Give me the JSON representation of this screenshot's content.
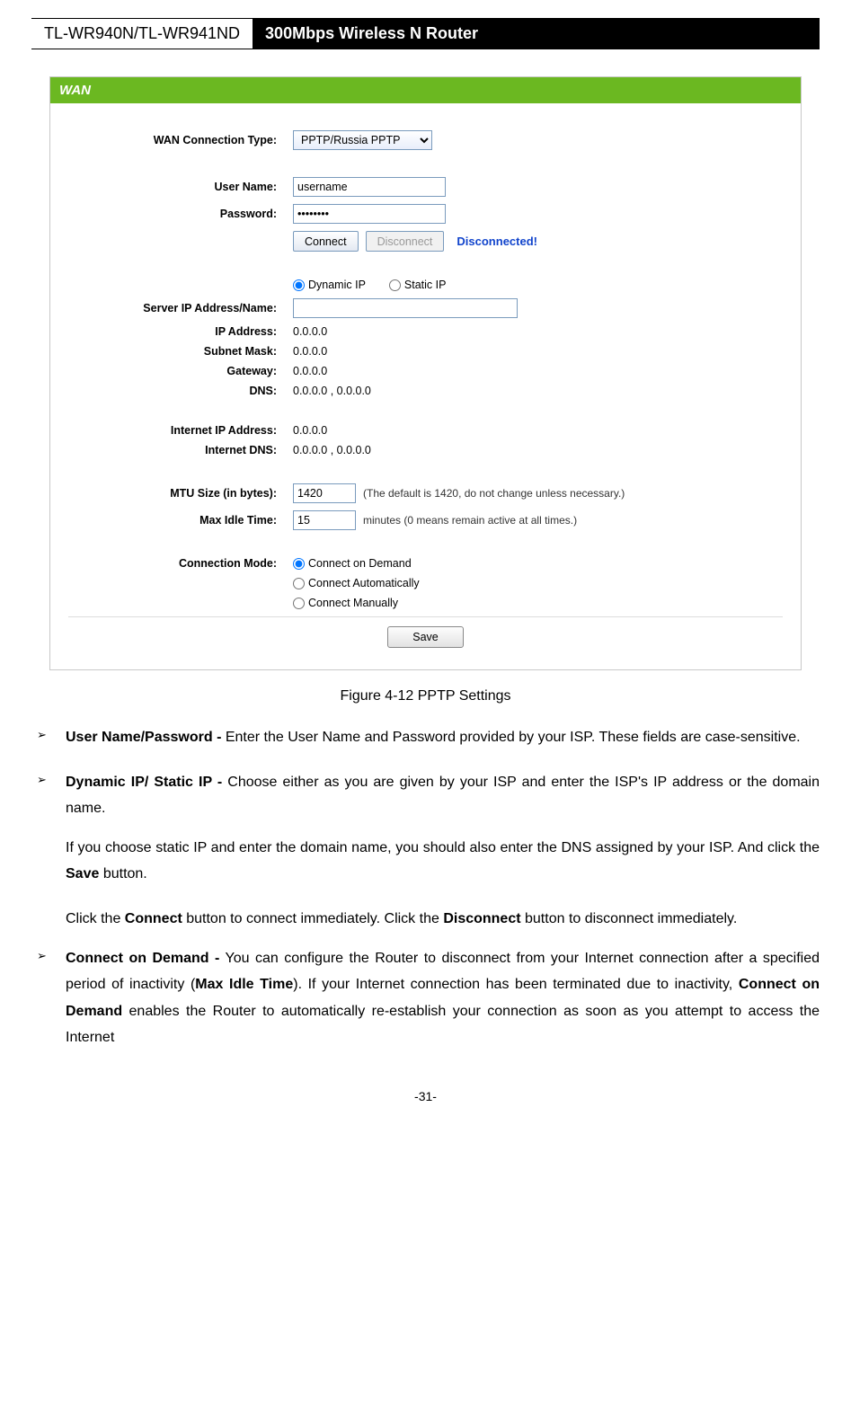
{
  "header": {
    "model": "TL-WR940N/TL-WR941ND",
    "title": "300Mbps Wireless N Router"
  },
  "panel": {
    "title": "WAN",
    "conn_type_label": "WAN Connection Type:",
    "conn_type_value": "PPTP/Russia PPTP",
    "user_label": "User Name:",
    "user_value": "username",
    "pass_label": "Password:",
    "pass_value": "••••••••",
    "connect_btn": "Connect",
    "disconnect_btn": "Disconnect",
    "status": "Disconnected!",
    "dynip_label": "Dynamic IP",
    "staticip_label": "Static IP",
    "server_label": "Server IP Address/Name:",
    "server_value": "",
    "ip_label": "IP Address:",
    "ip_value": "0.0.0.0",
    "mask_label": "Subnet Mask:",
    "mask_value": "0.0.0.0",
    "gw_label": "Gateway:",
    "gw_value": "0.0.0.0",
    "dns_label": "DNS:",
    "dns_value": "0.0.0.0 , 0.0.0.0",
    "iip_label": "Internet IP Address:",
    "iip_value": "0.0.0.0",
    "idns_label": "Internet DNS:",
    "idns_value": "0.0.0.0 , 0.0.0.0",
    "mtu_label": "MTU Size (in bytes):",
    "mtu_value": "1420",
    "mtu_hint": "(The default is 1420, do not change unless necessary.)",
    "idle_label": "Max Idle Time:",
    "idle_value": "15",
    "idle_hint": "minutes (0 means remain active at all times.)",
    "mode_label": "Connection Mode:",
    "mode_opt1": "Connect on Demand",
    "mode_opt2": "Connect Automatically",
    "mode_opt3": "Connect Manually",
    "save_btn": "Save"
  },
  "caption": "Figure 4-12    PPTP Settings",
  "bullets": {
    "b1_bold": "User Name/Password -",
    "b1_text": " Enter the User Name and Password provided by your ISP. These fields are case-sensitive.",
    "b2_bold": "Dynamic IP/ Static IP -",
    "b2_text": " Choose either as you are given by your ISP and enter the ISP's IP address or the domain name.",
    "b2_note_a": "If you choose static IP and enter the domain name, you should also enter the DNS assigned by your ISP. And click the ",
    "b2_note_save": "Save",
    "b2_note_b": " button.",
    "b2_click_a": "Click the ",
    "b2_click_connect": "Connect",
    "b2_click_b": " button to connect immediately. Click the ",
    "b2_click_disconnect": "Disconnect",
    "b2_click_c": " button to disconnect immediately.",
    "b3_bold": "Connect on Demand -",
    "b3_text_a": " You can configure the Router to disconnect from your Internet connection after a specified period of inactivity (",
    "b3_mit": "Max Idle Time",
    "b3_text_b": "). If your Internet connection has been terminated due to inactivity, ",
    "b3_cod": "Connect on Demand",
    "b3_text_c": " enables the Router to automatically re-establish your connection as soon as you attempt to access the Internet"
  },
  "footer": "-31-",
  "bullet_char": "➢"
}
